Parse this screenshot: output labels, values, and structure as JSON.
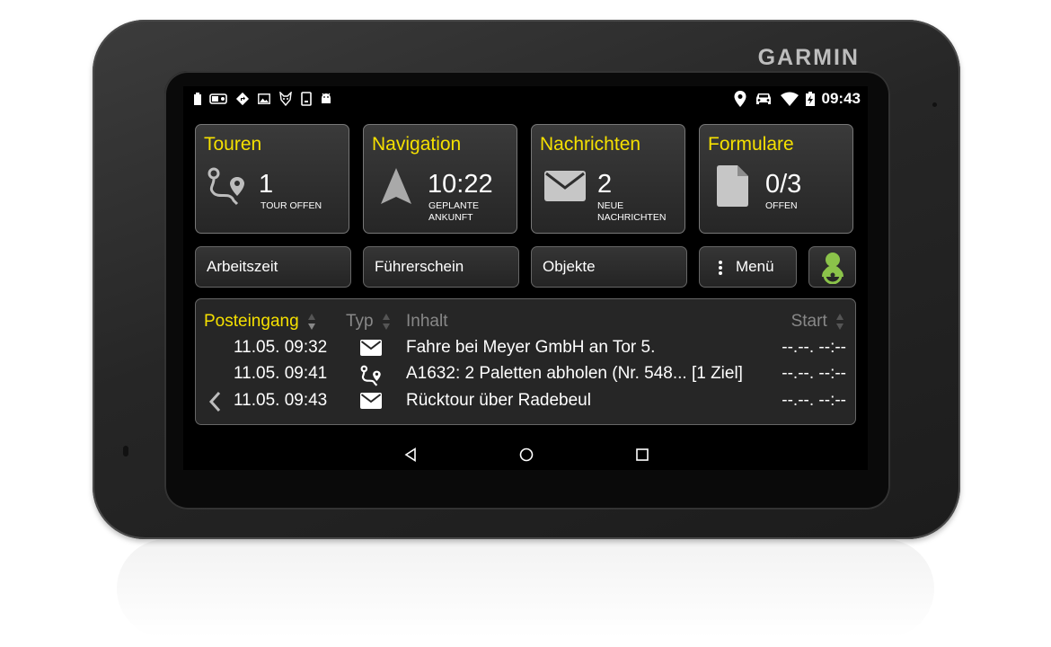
{
  "brand": "GARMIN",
  "status_bar": {
    "left_icons": [
      "battery-icon",
      "toggle-icon",
      "directions-icon",
      "image-icon",
      "fox-icon",
      "tablet-icon",
      "android-icon"
    ],
    "right_icons": [
      "location-pin-icon",
      "car-icon",
      "wifi-icon",
      "battery-charging-icon"
    ],
    "time": "09:43"
  },
  "tiles": [
    {
      "title": "Touren",
      "icon": "route-icon",
      "number": "1",
      "sub_line1": "TOUR OFFEN",
      "sub_line2": ""
    },
    {
      "title": "Navigation",
      "icon": "navigation-arrow-icon",
      "number": "10:22",
      "sub_line1": "GEPLANTE",
      "sub_line2": "ANKUNFT"
    },
    {
      "title": "Nachrichten",
      "icon": "envelope-icon",
      "number": "2",
      "sub_line1": "NEUE",
      "sub_line2": "NACHRICHTEN"
    },
    {
      "title": "Formulare",
      "icon": "document-icon",
      "number": "0/3",
      "sub_line1": "OFFEN",
      "sub_line2": ""
    }
  ],
  "buttons": {
    "arbeitszeit": "Arbeitszeit",
    "fuehrerschein": "Führerschein",
    "objekte": "Objekte",
    "menu": "Menü",
    "driver_icon": "driver-steering-wheel-icon"
  },
  "inbox": {
    "headers": {
      "folder": "Posteingang",
      "type": "Typ",
      "content": "Inhalt",
      "start": "Start"
    },
    "rows": [
      {
        "date": "11.05. 09:32",
        "type_icon": "envelope-icon",
        "content": "Fahre bei Meyer GmbH an Tor 5.",
        "start": "--.--. --:--"
      },
      {
        "date": "11.05. 09:41",
        "type_icon": "route-icon",
        "content": "A1632: 2 Paletten abholen (Nr. 548...  [1 Ziel]",
        "start": "--.--. --:--"
      },
      {
        "date": "11.05. 09:43",
        "type_icon": "envelope-icon",
        "content": "Rücktour über Radebeul",
        "start": "--.--. --:--"
      }
    ]
  },
  "colors": {
    "accent": "#f5e000",
    "driver_green": "#8bc34a",
    "tile_bg": "#2e2e2e",
    "screen_bg": "#000000"
  }
}
